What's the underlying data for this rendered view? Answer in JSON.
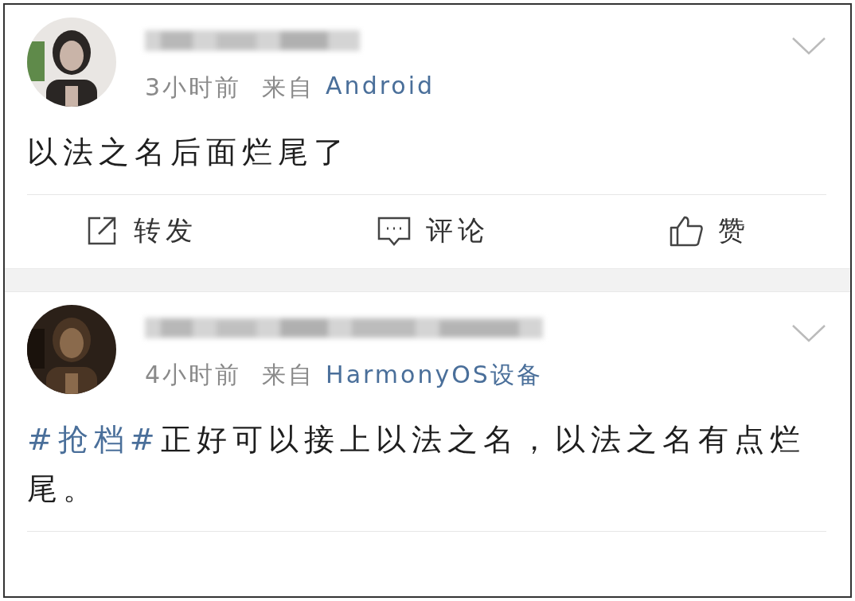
{
  "posts": [
    {
      "avatar": {
        "kind": "picture"
      },
      "time": "3小时前",
      "source_prefix": "来自",
      "source": "Android",
      "content": [
        {
          "kind": "text",
          "text": "以法之名后面烂尾了"
        }
      ],
      "actions": [
        {
          "kind": "repost",
          "label": "转发"
        },
        {
          "kind": "comment",
          "label": "评论"
        },
        {
          "kind": "like",
          "label": "赞"
        }
      ]
    },
    {
      "avatar": {
        "kind": "picture"
      },
      "time": "4小时前",
      "source_prefix": "来自",
      "source": "HarmonyOS设备",
      "content": [
        {
          "kind": "hashtag",
          "text": "#抢档#"
        },
        {
          "kind": "text",
          "text": "正好可以接上以法之名，以法之名有点烂尾。"
        }
      ]
    }
  ]
}
